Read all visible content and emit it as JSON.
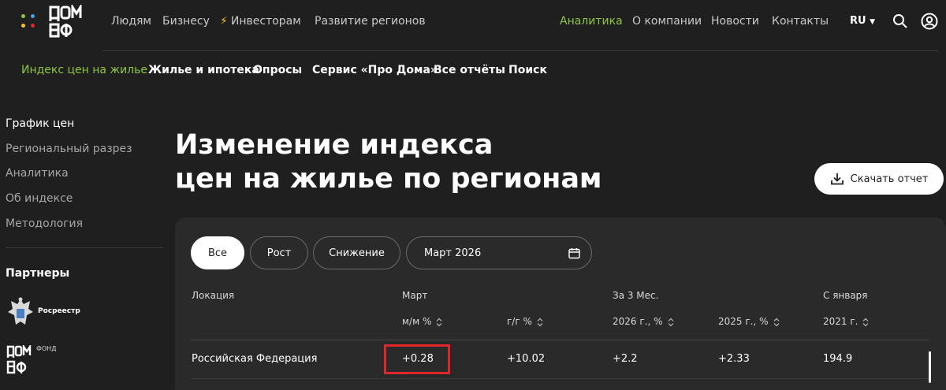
{
  "header": {
    "nav": [
      "Людям",
      "Бизнесу",
      "Инвесторам",
      "Развитие регионов"
    ],
    "nav_right": [
      "Аналитика",
      "О компании",
      "Новости",
      "Контакты"
    ],
    "lang": "RU",
    "icons": [
      "logo-dots-icon",
      "domrf-logo-icon",
      "lightning-icon",
      "chevron-down-icon",
      "search-icon",
      "user-icon"
    ]
  },
  "subnav": [
    "Индекс цен на жилье",
    "Жилье и ипотека",
    "Опросы",
    "Сервис «Про Дома»",
    "Все отчёты",
    "Поиск"
  ],
  "sidebar": {
    "items": [
      "График цен",
      "Региональный разрез",
      "Аналитика",
      "Об индексе",
      "Методология"
    ],
    "partners_title": "Партнеры",
    "partner_1": "Росреестр",
    "partner_2": "ФОНД"
  },
  "page": {
    "title_line1": "Изменение индекса",
    "title_line2": "цен на жилье по регионам",
    "download_label": "Скачать отчет"
  },
  "filters": {
    "buttons": [
      "Все",
      "Рост",
      "Снижение"
    ],
    "selected": "Все",
    "date": "Март 2026"
  },
  "table": {
    "headers": {
      "location": "Локация",
      "group_march": "Март",
      "group_3m": "За 3 Мес.",
      "group_jan": "С января",
      "mm": "м/м %",
      "yy": "г/г %",
      "y2026": "2026 г., %",
      "y2025": "2025 г., %",
      "y2021": "2021 г."
    },
    "rows": [
      {
        "location": "Российская Федерация",
        "mm": "+0.28",
        "yy": "+10.02",
        "y2026": "+2.2",
        "y2025": "+2.33",
        "y2021": "194.9"
      }
    ]
  },
  "colors": {
    "accent": "#8fc543",
    "highlight": "#e0262b",
    "background": "#1f1f1f",
    "card": "#2a2a2a"
  }
}
